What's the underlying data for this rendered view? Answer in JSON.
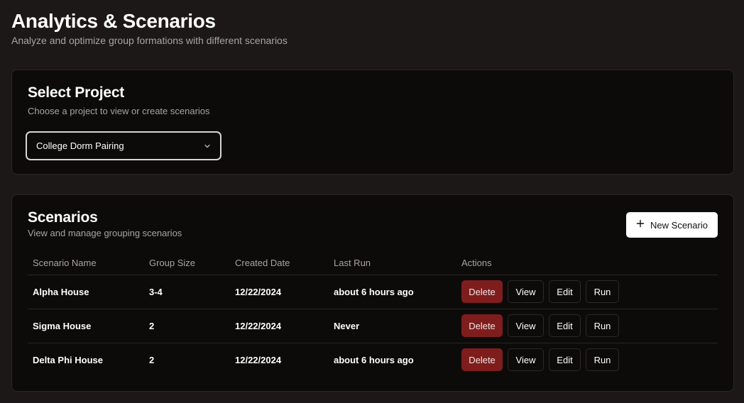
{
  "header": {
    "title": "Analytics & Scenarios",
    "subtitle": "Analyze and optimize group formations with different scenarios"
  },
  "project_card": {
    "title": "Select Project",
    "description": "Choose a project to view or create scenarios",
    "selected_project": "College Dorm Pairing",
    "select_icon": "chevron-down-icon"
  },
  "scenarios_card": {
    "title": "Scenarios",
    "description": "View and manage grouping scenarios",
    "new_button_label": "New Scenario",
    "new_button_icon": "plus-icon",
    "columns": [
      "Scenario Name",
      "Group Size",
      "Created Date",
      "Last Run",
      "Actions"
    ],
    "rows": [
      {
        "name": "Alpha House",
        "group_size": "3-4",
        "created": "12/22/2024",
        "last_run": "about 6 hours ago"
      },
      {
        "name": "Sigma House",
        "group_size": "2",
        "created": "12/22/2024",
        "last_run": "Never"
      },
      {
        "name": "Delta Phi House",
        "group_size": "2",
        "created": "12/22/2024",
        "last_run": "about 6 hours ago"
      }
    ],
    "action_labels": {
      "delete": "Delete",
      "view": "View",
      "edit": "Edit",
      "run": "Run"
    }
  },
  "colors": {
    "background": "#1b1817",
    "card": "#0c0b0a",
    "delete_button": "#7f1d1d",
    "primary_button": "#ffffff"
  }
}
